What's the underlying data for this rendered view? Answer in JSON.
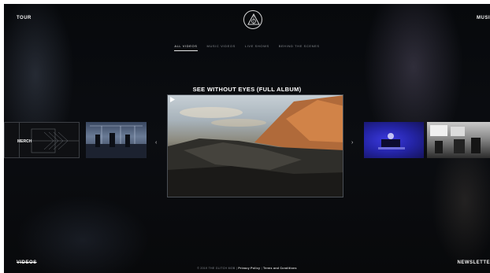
{
  "corners": {
    "top_left": "TOUR",
    "top_right": "MUSI",
    "bottom_left": "VIDEOS",
    "bottom_right": "NEWSLETTE"
  },
  "nav": {
    "tabs": [
      {
        "label": "ALL VIDEOS",
        "active": true
      },
      {
        "label": "MUSIC VIDEOS",
        "active": false
      },
      {
        "label": "LIVE SHOWS",
        "active": false
      },
      {
        "label": "BEHIND THE SCENES",
        "active": false
      }
    ]
  },
  "featured": {
    "title": "SEE WITHOUT EYES (FULL ALBUM)"
  },
  "carousel": {
    "left_thumb_label": "MERCH",
    "prev_arrow": "‹",
    "next_arrow": "›"
  },
  "footer": {
    "copyright": "© 2019 THE GLITCH MOB",
    "separator": "|",
    "privacy": "Privacy Policy",
    "terms": "Terms and Conditions"
  },
  "icons": {
    "logo": "triangle-logo-icon",
    "play": "play-icon"
  }
}
